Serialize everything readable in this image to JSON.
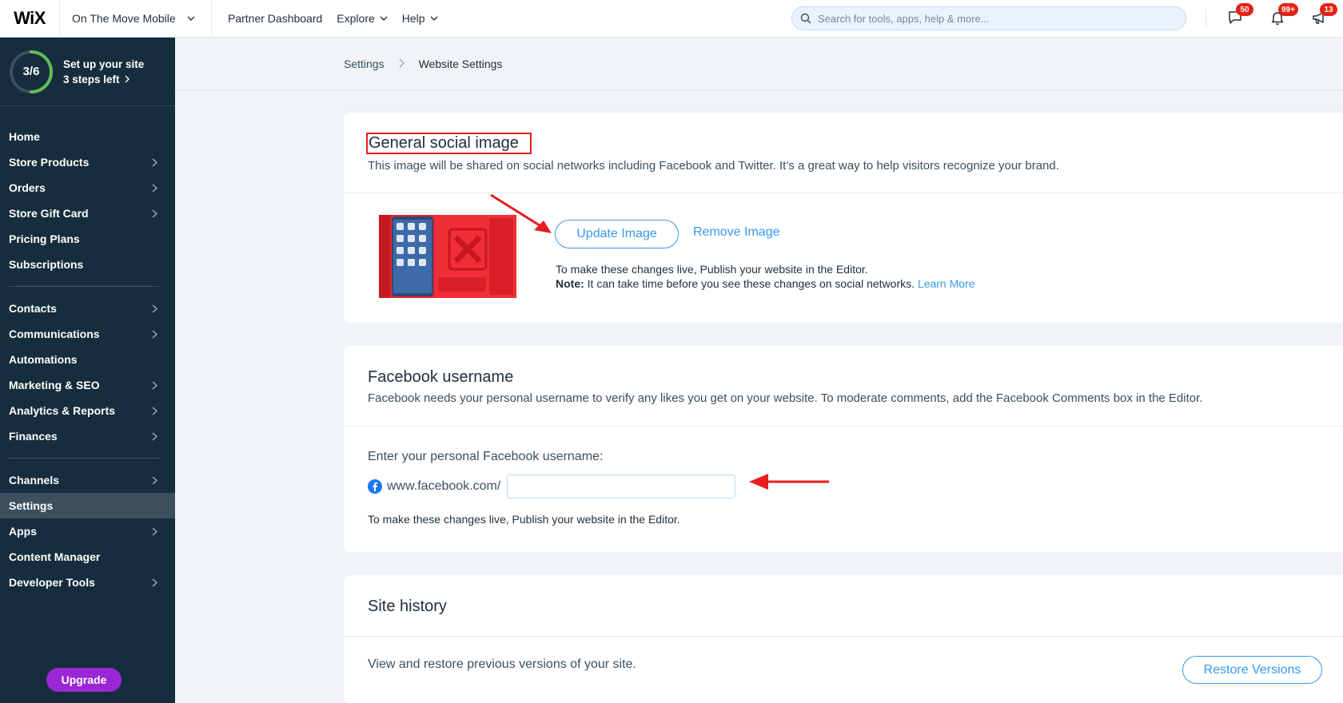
{
  "topbar": {
    "logo": "WiX",
    "site_name": "On The Move Mobile",
    "nav": [
      {
        "label": "Partner Dashboard",
        "has_chevron": false
      },
      {
        "label": "Explore",
        "has_chevron": true
      },
      {
        "label": "Help",
        "has_chevron": true
      }
    ],
    "search_placeholder": "Search for tools, apps, help & more...",
    "badges": {
      "messages": "50",
      "notifications": "99+",
      "announcements": "13"
    }
  },
  "sidebar": {
    "setup": {
      "progress": "3/6",
      "progress_fraction": 0.5,
      "title": "Set up your site",
      "subtitle": "3 steps left"
    },
    "group1": [
      {
        "label": "Home",
        "chevron": false
      },
      {
        "label": "Store Products",
        "chevron": true
      },
      {
        "label": "Orders",
        "chevron": true
      },
      {
        "label": "Store Gift Card",
        "chevron": true
      },
      {
        "label": "Pricing Plans",
        "chevron": false
      },
      {
        "label": "Subscriptions",
        "chevron": false
      }
    ],
    "group2": [
      {
        "label": "Contacts",
        "chevron": true
      },
      {
        "label": "Communications",
        "chevron": true
      },
      {
        "label": "Automations",
        "chevron": false
      },
      {
        "label": "Marketing & SEO",
        "chevron": true
      },
      {
        "label": "Analytics & Reports",
        "chevron": true
      },
      {
        "label": "Finances",
        "chevron": true
      }
    ],
    "group3": [
      {
        "label": "Channels",
        "chevron": true
      },
      {
        "label": "Settings",
        "chevron": false,
        "active": true
      },
      {
        "label": "Apps",
        "chevron": true
      },
      {
        "label": "Content Manager",
        "chevron": false
      },
      {
        "label": "Developer Tools",
        "chevron": true
      }
    ],
    "upgrade": "Upgrade"
  },
  "breadcrumb": {
    "parent": "Settings",
    "current": "Website Settings"
  },
  "social_image": {
    "title": "General social image",
    "description": "This image will be shared on social networks including Facebook and Twitter. It’s a great way to help visitors recognize your brand.",
    "update_button": "Update Image",
    "remove_link": "Remove Image",
    "note_line1": "To make these changes live, Publish your website in the Editor.",
    "note_label": "Note:",
    "note_line2": " It can take time before you see these changes on social networks. ",
    "learn_more": "Learn More"
  },
  "facebook": {
    "title": "Facebook username",
    "description": "Facebook needs your personal username to verify any likes you get on your website. To moderate comments, add the Facebook Comments box in the Editor.",
    "field_label": "Enter your personal Facebook username:",
    "prefix": "www.facebook.com/",
    "value": "",
    "note": "To make these changes live, Publish your website in the Editor."
  },
  "site_history": {
    "title": "Site history",
    "description": "View and restore previous versions of your site.",
    "restore_button": "Restore Versions"
  },
  "colors": {
    "accent": "#3899ec",
    "sidebar": "#162d3d",
    "badge": "#e62214",
    "upgrade": "#9a27d5",
    "annotation": "#e61e1e"
  }
}
